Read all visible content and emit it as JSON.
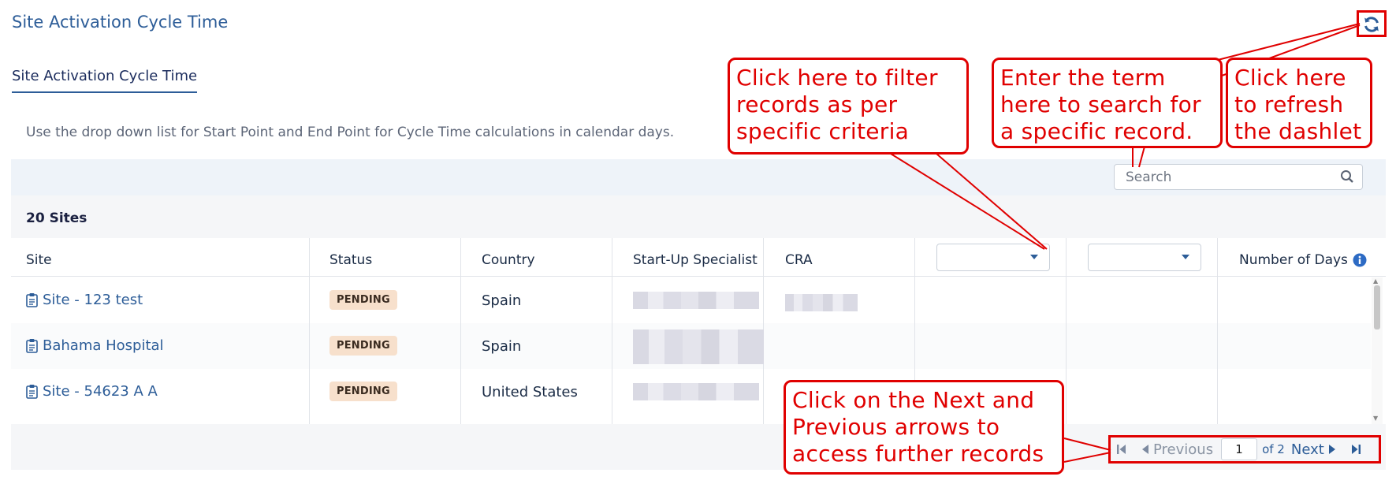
{
  "header": {
    "title": "Site Activation Cycle Time",
    "refresh_icon": "refresh-icon"
  },
  "tabs": [
    {
      "label": "Site Activation Cycle Time",
      "active": true
    }
  ],
  "description": "Use the drop down list for Start Point and End Point for Cycle Time calculations in calendar days.",
  "search": {
    "placeholder": "Search",
    "value": ""
  },
  "summary": {
    "count_label": "20 Sites"
  },
  "table": {
    "columns": [
      "Site",
      "Status",
      "Country",
      "Start-Up Specialist",
      "CRA",
      "",
      "",
      "Number of Days"
    ],
    "rows": [
      {
        "site": "Site - 123 test",
        "status": "PENDING",
        "country": "Spain"
      },
      {
        "site": "Bahama Hospital",
        "status": "PENDING",
        "country": "Spain"
      },
      {
        "site": "Site - 54623 A A",
        "status": "PENDING",
        "country": "United States"
      }
    ]
  },
  "pagination": {
    "previous_label": "Previous",
    "next_label": "Next",
    "current_page": "1",
    "of_label": "of 2"
  },
  "annotations": {
    "filter": "Click here to filter records as per specific criteria",
    "search": "Enter the term here to search for a specific record.",
    "refresh": "Click here to refresh the dashlet",
    "pager": "Click on the Next and Previous arrows to access further records"
  },
  "colors": {
    "accent": "#2d5d98",
    "annotation": "#e00000",
    "badge_bg": "#f7e0cc"
  }
}
